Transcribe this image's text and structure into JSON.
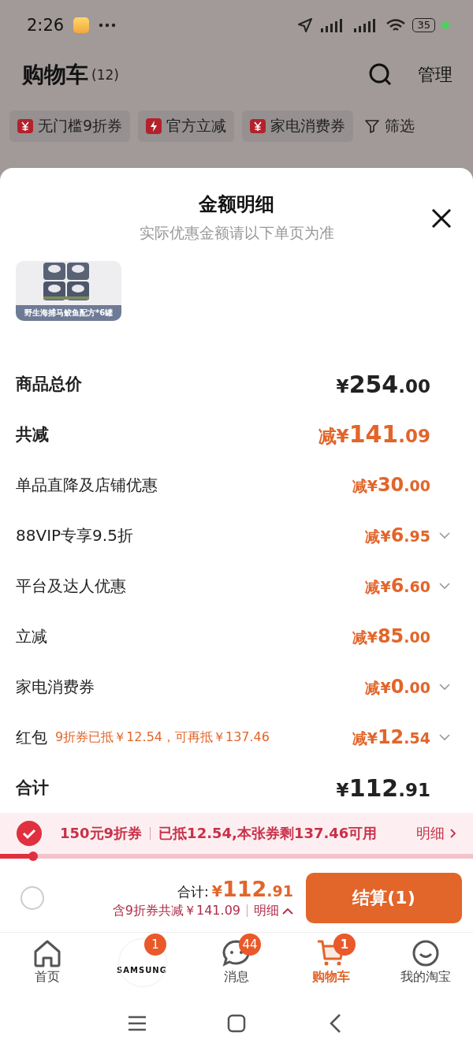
{
  "status_bar": {
    "time": "2:26",
    "battery": "35"
  },
  "header": {
    "title": "购物车",
    "count": "(12)",
    "manage": "管理"
  },
  "chips": [
    {
      "label": "无门槛9折券",
      "kind": "coupon"
    },
    {
      "label": "官方立减",
      "kind": "flash"
    },
    {
      "label": "家电消费券",
      "kind": "coupon"
    },
    {
      "label": "筛选",
      "kind": "filter"
    }
  ],
  "sheet": {
    "title": "金额明细",
    "subtitle": "实际优惠金额请以下单页为准",
    "product": {
      "kind": "picture",
      "caption": "野生海捕马鲛鱼配方*6罐"
    },
    "rows": [
      {
        "label": "商品总价",
        "amount": "¥254.00",
        "kind": "total",
        "expandable": false
      },
      {
        "label": "共减",
        "amount": "减¥141.09",
        "kind": "discount_total",
        "expandable": false
      },
      {
        "label": "单品直降及店铺优惠",
        "amount": "减¥30.00",
        "kind": "discount",
        "expandable": false
      },
      {
        "label": "88VIP专享9.5折",
        "amount": "减¥6.95",
        "kind": "discount",
        "expandable": true
      },
      {
        "label": "平台及达人优惠",
        "amount": "减¥6.60",
        "kind": "discount",
        "expandable": true
      },
      {
        "label": "立减",
        "amount": "减¥85.00",
        "kind": "discount",
        "expandable": false
      },
      {
        "label": "家电消费券",
        "amount": "减¥0.00",
        "kind": "discount",
        "expandable": true
      },
      {
        "label": "红包",
        "note": "9折券已抵￥12.54，可再抵￥137.46",
        "amount": "减¥12.54",
        "kind": "discount",
        "expandable": true
      },
      {
        "label": "合计",
        "amount": "¥112.91",
        "kind": "total",
        "expandable": false
      }
    ]
  },
  "coupon_bar": {
    "checked": true,
    "name": "150元9折券",
    "detail": "已抵12.54,本张券剩137.46可用",
    "link": "明细",
    "level": 0.07
  },
  "checkout": {
    "select_all_checked": false,
    "total_label": "合计:",
    "total": "¥112.91",
    "saving": "含9折券共减￥141.09",
    "detail": "明细",
    "button": "结算(1)"
  },
  "tab_bar": [
    {
      "label": "首页",
      "kind": "home",
      "selected": false
    },
    {
      "logo": "SAMSUNG",
      "badge": "1",
      "kind": "logo",
      "selected": false
    },
    {
      "label": "消息",
      "badge": "44",
      "kind": "chat",
      "selected": false
    },
    {
      "label": "购物车",
      "badge": "1",
      "kind": "cart",
      "selected": true
    },
    {
      "label": "我的淘宝",
      "kind": "smile",
      "selected": false
    }
  ]
}
